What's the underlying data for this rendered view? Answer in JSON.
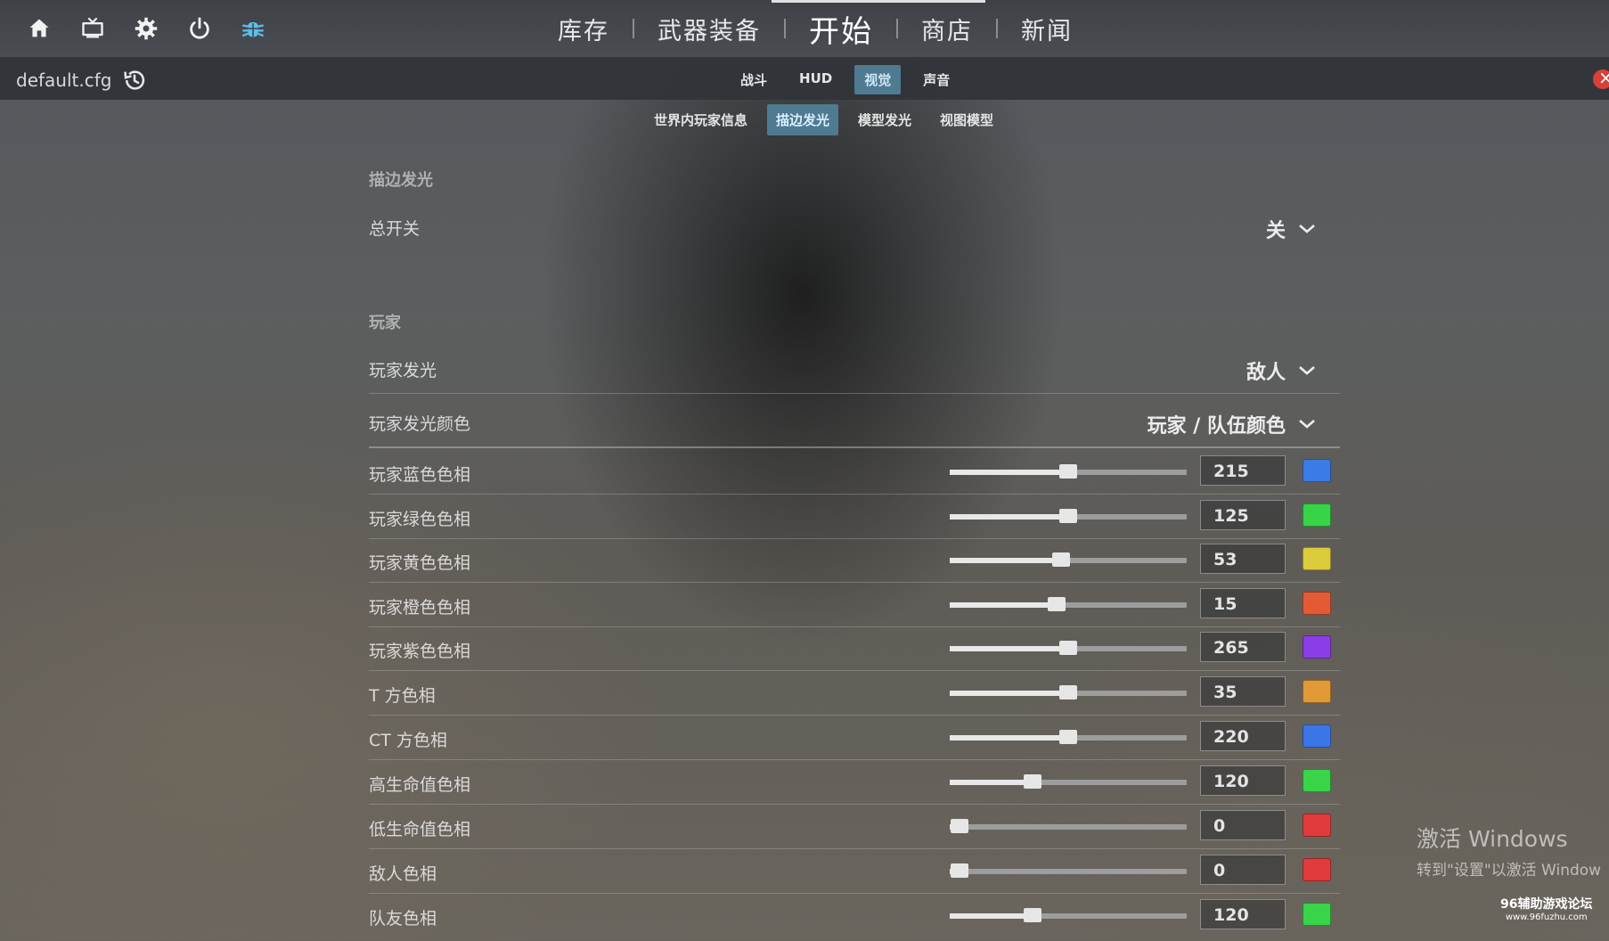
{
  "topbar": {
    "icons": [
      "home-icon",
      "tv-icon",
      "gear-icon",
      "power-icon",
      "bug-icon"
    ],
    "nav": [
      {
        "label": "库存"
      },
      {
        "label": "武器装备"
      },
      {
        "label": "开始",
        "active": true
      },
      {
        "label": "商店"
      },
      {
        "label": "新闻"
      }
    ]
  },
  "subbar": {
    "config_name": "default.cfg",
    "tabs": [
      {
        "label": "战斗"
      },
      {
        "label": "HUD"
      },
      {
        "label": "视觉",
        "active": true
      },
      {
        "label": "声音"
      }
    ]
  },
  "sub_tabs": [
    {
      "label": "世界内玩家信息"
    },
    {
      "label": "描边发光",
      "active": true
    },
    {
      "label": "模型发光"
    },
    {
      "label": "视图模型"
    }
  ],
  "outline_section": {
    "title": "描边发光",
    "master_switch": {
      "label": "总开关",
      "value": "关"
    }
  },
  "player_section": {
    "title": "玩家",
    "player_glow": {
      "label": "玩家发光",
      "value": "敌人"
    },
    "player_glow_color": {
      "label": "玩家发光颜色",
      "value": "玩家 / 队伍颜色"
    }
  },
  "hue_rows": [
    {
      "label": "玩家蓝色色相",
      "value": "215",
      "level": 0.5,
      "color": "#3b7be6"
    },
    {
      "label": "玩家绿色色相",
      "value": "125",
      "level": 0.5,
      "color": "#37d447"
    },
    {
      "label": "玩家黄色色相",
      "value": "53",
      "level": 0.47,
      "color": "#dccb3c"
    },
    {
      "label": "玩家橙色色相",
      "value": "15",
      "level": 0.45,
      "color": "#e35b35"
    },
    {
      "label": "玩家紫色色相",
      "value": "265",
      "level": 0.5,
      "color": "#8b3de6"
    },
    {
      "label": "T 方色相",
      "value": "35",
      "level": 0.5,
      "color": "#e29a36"
    },
    {
      "label": "CT 方色相",
      "value": "220",
      "level": 0.5,
      "color": "#3b76e8"
    },
    {
      "label": "高生命值色相",
      "value": "120",
      "level": 0.35,
      "color": "#39d44a"
    },
    {
      "label": "低生命值色相",
      "value": "0",
      "level": 0.04,
      "color": "#e23b3b"
    },
    {
      "label": "敌人色相",
      "value": "0",
      "level": 0.04,
      "color": "#e23b3b"
    },
    {
      "label": "队友色相",
      "value": "120",
      "level": 0.35,
      "color": "#39d44a"
    }
  ],
  "watermark": {
    "line1": "激活 Windows",
    "line2": "转到\"设置\"以激活 Window"
  },
  "forum": {
    "name": "96辅助游戏论坛",
    "url": "www.96fuzhu.com"
  }
}
